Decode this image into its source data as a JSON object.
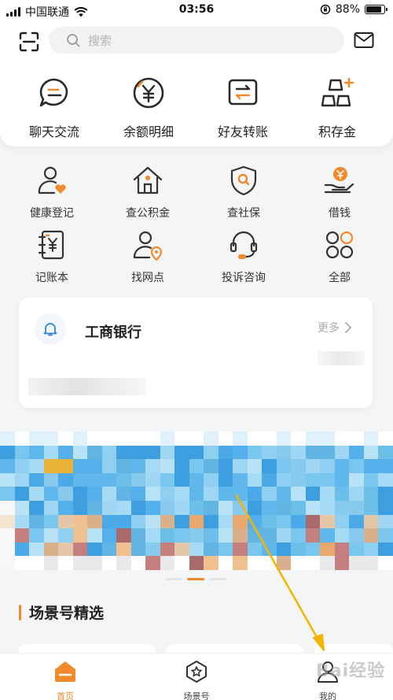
{
  "status_bar": {
    "carrier": "中国联通",
    "time": "03:56",
    "battery": "88%",
    "battery_level": 0.88
  },
  "search": {
    "placeholder": "搜索"
  },
  "quick_actions": [
    {
      "label": "聊天交流",
      "icon": "chat-icon"
    },
    {
      "label": "余额明细",
      "icon": "yuan-coin-icon"
    },
    {
      "label": "好友转账",
      "icon": "transfer-icon"
    },
    {
      "label": "积存金",
      "icon": "gold-bars-icon"
    }
  ],
  "services": [
    {
      "label": "健康登记",
      "icon": "health-person-icon"
    },
    {
      "label": "查公积金",
      "icon": "housing-fund-icon"
    },
    {
      "label": "查社保",
      "icon": "social-security-shield-icon"
    },
    {
      "label": "借钱",
      "icon": "loan-hand-coin-icon"
    },
    {
      "label": "记账本",
      "icon": "ledger-book-icon"
    },
    {
      "label": "找网点",
      "icon": "branch-locator-icon"
    },
    {
      "label": "投诉咨询",
      "icon": "headset-icon"
    },
    {
      "label": "全部",
      "icon": "all-grid-icon"
    }
  ],
  "bank_card": {
    "name": "工商银行",
    "more": "更多"
  },
  "section": {
    "title": "场景号精选"
  },
  "tabs": [
    {
      "label": "首页",
      "icon": "home-icon",
      "active": true
    },
    {
      "label": "场景号",
      "icon": "star-hexagon-icon",
      "active": false
    },
    {
      "label": "我的",
      "icon": "profile-icon",
      "active": false
    }
  ],
  "watermark": "Bai经验",
  "colors": {
    "accent": "#f08a2c",
    "bell_blue": "#3a7fd8",
    "arrow": "#f5b400"
  }
}
